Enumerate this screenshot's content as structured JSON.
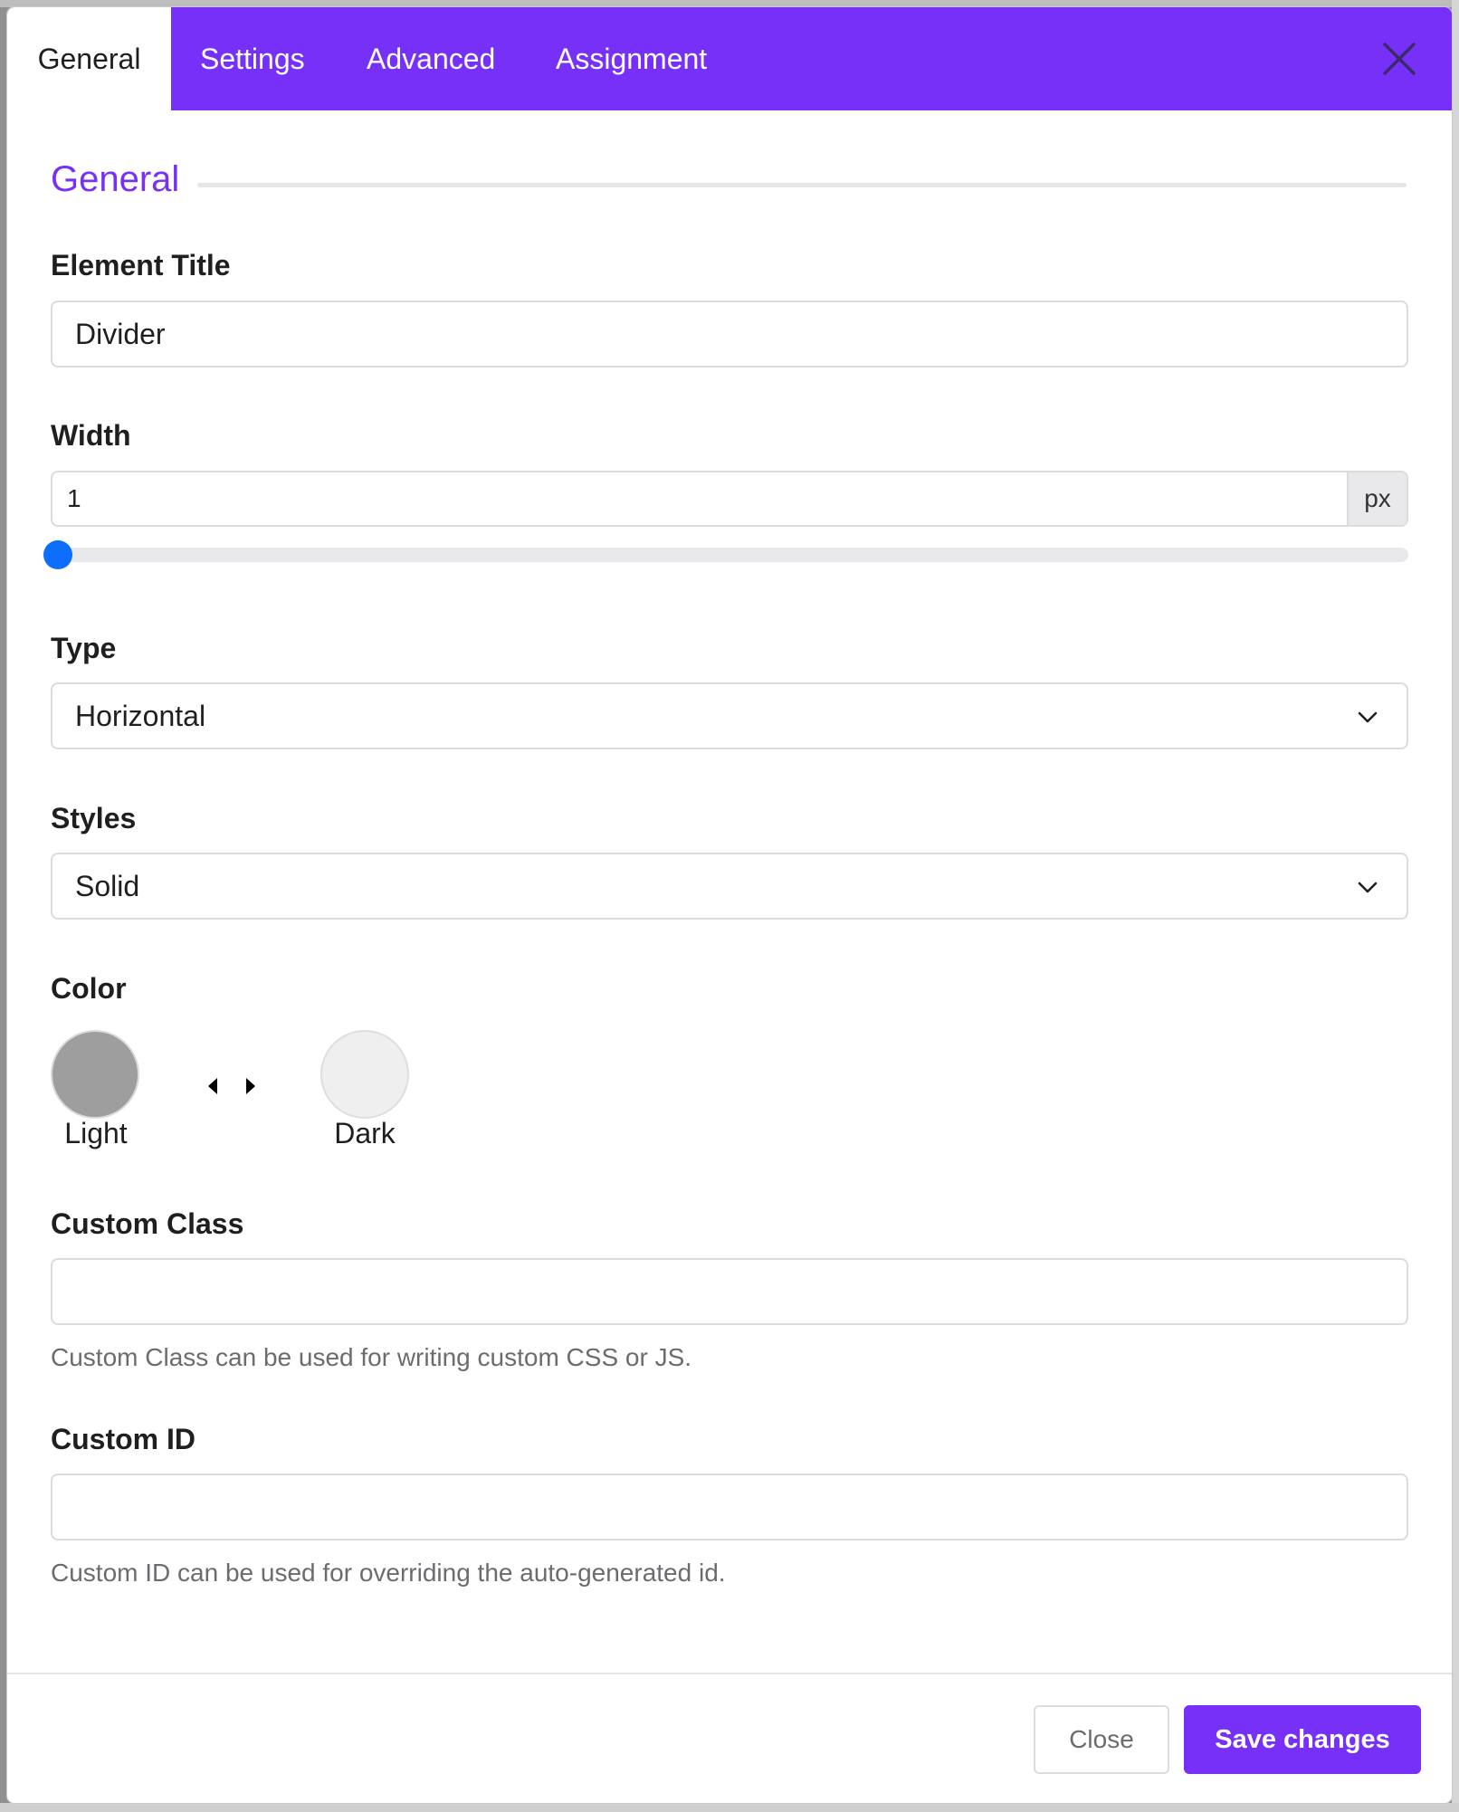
{
  "tabs": [
    {
      "label": "General",
      "active": true
    },
    {
      "label": "Settings"
    },
    {
      "label": "Advanced"
    },
    {
      "label": "Assignment"
    }
  ],
  "section": {
    "title": "General"
  },
  "fields": {
    "element_title": {
      "label": "Element Title",
      "value": "Divider"
    },
    "width": {
      "label": "Width",
      "value": "1",
      "unit": "px",
      "slider_fraction": 0.0
    },
    "type": {
      "label": "Type",
      "value": "Horizontal"
    },
    "styles": {
      "label": "Styles",
      "value": "Solid"
    },
    "color": {
      "label": "Color",
      "light": {
        "label": "Light",
        "hex": "#9e9e9e"
      },
      "dark": {
        "label": "Dark",
        "hex": "#efefef"
      }
    },
    "custom_class": {
      "label": "Custom Class",
      "value": "",
      "help": "Custom Class can be used for writing custom CSS or JS."
    },
    "custom_id": {
      "label": "Custom ID",
      "value": "",
      "help": "Custom ID can be used for overriding the auto-generated id."
    }
  },
  "footer": {
    "close_label": "Close",
    "save_label": "Save changes"
  },
  "colors": {
    "accent": "#7630f8",
    "slider": "#0d6efd"
  },
  "icons": {
    "close": "close-icon",
    "chevron": "chevron-down-icon",
    "arrows": "left-right-arrows-icon"
  }
}
